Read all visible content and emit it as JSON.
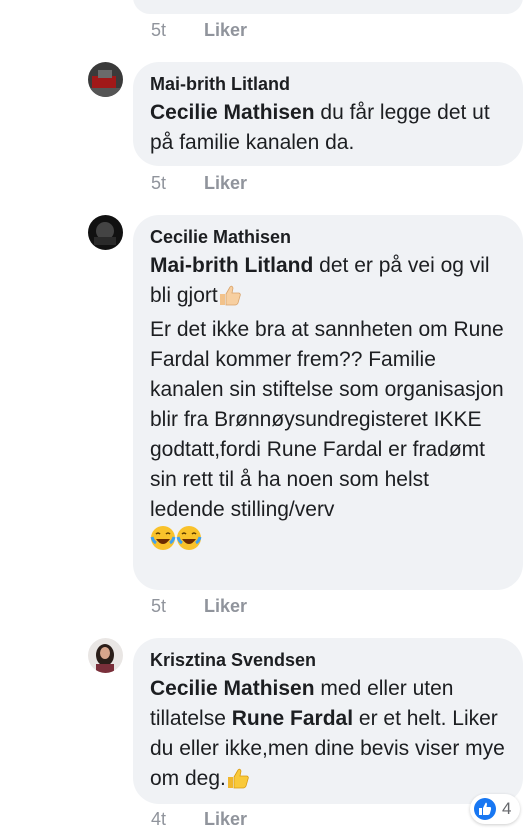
{
  "comments": [
    {
      "meta": {
        "time": "5t",
        "like": "Liker"
      }
    },
    {
      "author": "Mai-brith Litland",
      "mention": "Cecilie Mathisen",
      "text": " du får legge det ut på familie kanalen da.",
      "meta": {
        "time": "5t",
        "like": "Liker"
      }
    },
    {
      "author": "Cecilie Mathisen",
      "mention": "Mai-brith Litland",
      "text_line1": " det er på vei og vil bli gjort",
      "text_rest": "Er det ikke bra at sannheten om Rune Fardal kommer frem?? Familie kanalen sin stiftelse som organisasjon blir fra Brønnøysundregisteret IKKE godtatt,fordi Rune Fardal er fradømt sin rett til å ha noen som helst ledende stilling/verv",
      "meta": {
        "time": "5t",
        "like": "Liker"
      }
    },
    {
      "author": "Krisztina Svendsen",
      "mention1": "Cecilie Mathisen",
      "text1": " med eller uten tillatelse ",
      "mention2": "Rune Fardal",
      "text2": " er et helt. Liker du eller ikke,men dine bevis viser mye om deg.",
      "reaction_count": "4",
      "meta": {
        "time": "4t",
        "like": "Liker"
      }
    }
  ],
  "colors": {
    "bubble": "#f0f2f5",
    "meta": "#90949c",
    "like_blue": "#1877f2"
  }
}
